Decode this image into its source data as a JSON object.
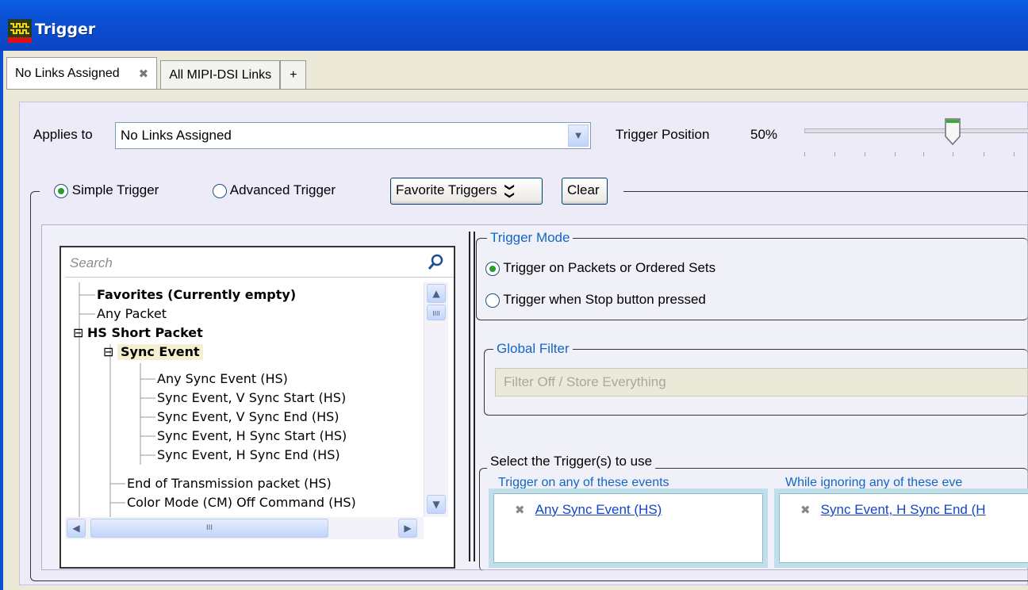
{
  "window": {
    "title": "Trigger"
  },
  "tabs": [
    {
      "label": "No Links Assigned",
      "close": "✖"
    },
    {
      "label": "All MIPI-DSI Links"
    },
    {
      "label": "+"
    }
  ],
  "applies_to": {
    "label": "Applies to",
    "value": "No Links Assigned"
  },
  "trigger_position": {
    "label": "Trigger Position",
    "value": "50%",
    "fraction": 0.5
  },
  "trigger_type": {
    "simple_label": "Simple Trigger",
    "advanced_label": "Advanced Trigger",
    "selected": "simple",
    "favorites_button": "Favorite Triggers",
    "favorites_icon": "❯❯",
    "clear_button": "Clear"
  },
  "search": {
    "placeholder": "Search"
  },
  "tree": [
    {
      "label": "Favorites (Currently empty)",
      "bold": true
    },
    {
      "label": "Any Packet"
    },
    {
      "label": "HS Short Packet",
      "bold": true,
      "toggle": "⊟"
    },
    {
      "label": "Sync Event",
      "bold": true,
      "toggle": "⊟",
      "selected": true
    },
    {
      "label": "Any Sync Event (HS)"
    },
    {
      "label": "Sync Event, V Sync Start (HS)"
    },
    {
      "label": "Sync Event, V Sync End (HS)"
    },
    {
      "label": "Sync Event, H Sync Start (HS)"
    },
    {
      "label": "Sync Event, H Sync End (HS)"
    },
    {
      "label": "End of Transmission packet (HS)"
    },
    {
      "label": "Color Mode (CM) Off Command (HS)"
    }
  ],
  "scroll": {
    "up": "▲",
    "down": "▼",
    "left": "◀",
    "right": "▶",
    "grip": "III",
    "vgrip": "IIII"
  },
  "trigger_mode": {
    "legend": "Trigger Mode",
    "option1": "Trigger on Packets or Ordered Sets",
    "option2": "Trigger when Stop button pressed",
    "selected": "option1"
  },
  "global_filter": {
    "legend": "Global Filter",
    "value": "Filter Off / Store Everything"
  },
  "select_triggers": {
    "legend": "Select the Trigger(s) to use",
    "any_header": "Trigger on any of these events",
    "ignore_header": "While ignoring any of these eve",
    "any_items": [
      "Any Sync Event (HS)"
    ],
    "ignore_items": [
      "Sync Event, H Sync End (H"
    ],
    "remove_icon": "✖"
  },
  "colors": {
    "title_bar": "#0b4fd2",
    "link": "#1445c8",
    "legend": "#1466c6",
    "list_bg": "#bfe0ea"
  }
}
